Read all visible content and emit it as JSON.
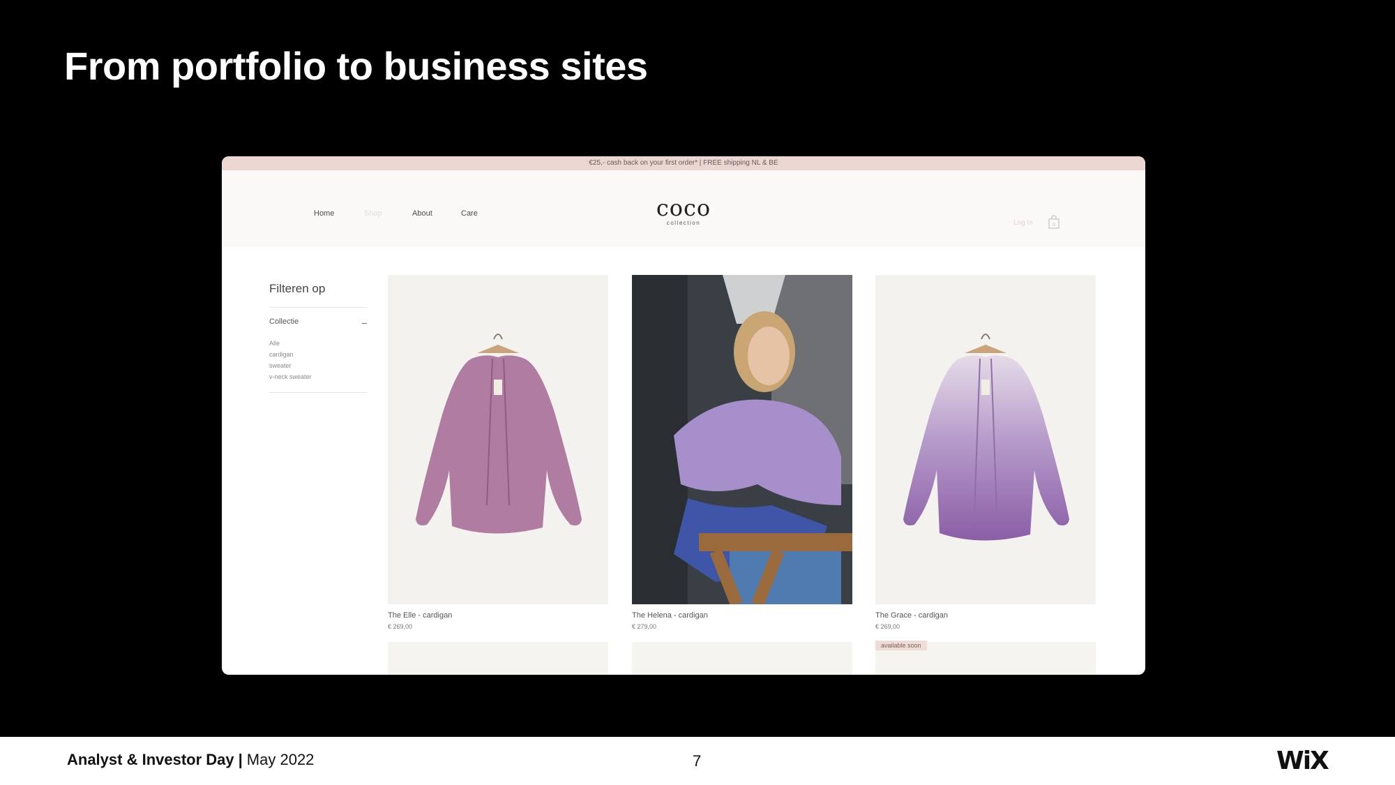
{
  "slide": {
    "title": "From portfolio to business sites",
    "footer": {
      "event": "Analyst & Investor Day",
      "separator": "|",
      "date": "May 2022",
      "page_number": "7",
      "logo": "WiX"
    }
  },
  "site": {
    "promo": "€25,- cash back on your first order* | FREE shipping NL & BE",
    "nav": [
      "Home",
      "Shop",
      "About",
      "Care"
    ],
    "logo_main": "coco",
    "logo_sub": "collection",
    "login": "Log In",
    "cart_icon": "shopping-bag-icon",
    "sidebar": {
      "title": "Filteren op",
      "collection_label": "Collectie",
      "collapse_symbol": "–",
      "filters": [
        "Alle",
        "cardigan",
        "sweater",
        "v-neck sweater"
      ]
    },
    "products": [
      {
        "name": "The Elle - cardigan",
        "price": "€ 269,00"
      },
      {
        "name": "The Helena - cardigan",
        "price": "€ 279,00"
      },
      {
        "name": "The Grace - cardigan",
        "price": "€ 269,00"
      }
    ],
    "badge": "available soon"
  }
}
